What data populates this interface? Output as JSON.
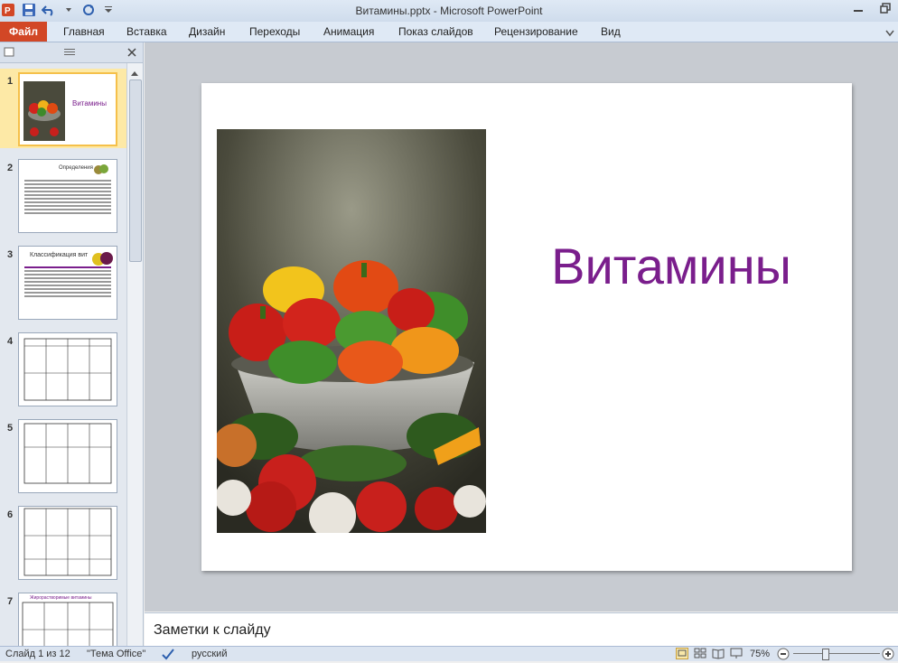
{
  "window": {
    "title": "Витамины.pptx - Microsoft PowerPoint"
  },
  "ribbon": {
    "file_tab": "Файл",
    "tabs": [
      "Главная",
      "Вставка",
      "Дизайн",
      "Переходы",
      "Анимация",
      "Показ слайдов",
      "Рецензирование",
      "Вид"
    ]
  },
  "thumbnails": [
    {
      "number": "1",
      "title": "Витамины"
    },
    {
      "number": "2",
      "title": "Определения"
    },
    {
      "number": "3",
      "title": "Классификация вит"
    },
    {
      "number": "4"
    },
    {
      "number": "5"
    },
    {
      "number": "6"
    },
    {
      "number": "7",
      "title": "Жирорастворимые витамины"
    }
  ],
  "slide": {
    "title": "Витамины"
  },
  "notes": {
    "placeholder": "Заметки к слайду"
  },
  "status": {
    "slide_info": "Слайд 1 из 12",
    "theme": "\"Тема Office\"",
    "language": "русский",
    "zoom": "75%"
  },
  "colors": {
    "file_tab": "#d24726",
    "title_purple": "#7a1e8c",
    "selected_thumb": "#fde9a6"
  }
}
